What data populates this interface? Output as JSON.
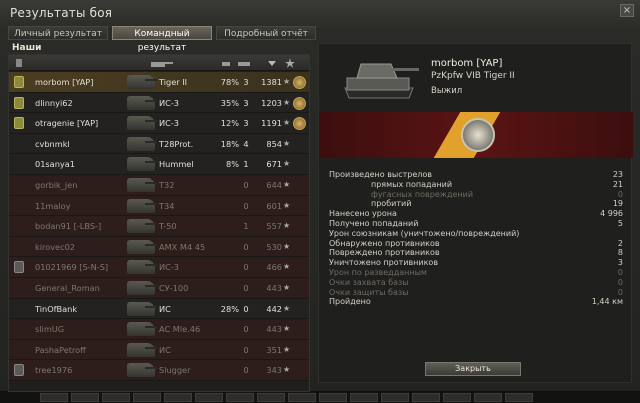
{
  "window": {
    "title": "Результаты боя",
    "close_label": "×"
  },
  "tabs": [
    {
      "label": "Личный результат",
      "active": false
    },
    {
      "label": "Командный результат",
      "active": true
    },
    {
      "label": "Подробный отчёт",
      "active": false
    }
  ],
  "team": {
    "header": "Наши"
  },
  "players": [
    {
      "name": "morbom [YAP]",
      "tank": "Tiger II",
      "pct": "78%",
      "kills": "3",
      "xp": "1381",
      "badge": "gold",
      "state": "self",
      "medal": true
    },
    {
      "name": "dlinnyi62",
      "tank": "ИС-3",
      "pct": "35%",
      "kills": "3",
      "xp": "1203",
      "badge": "gold",
      "state": "alive",
      "medal": true
    },
    {
      "name": "otragenie [YAP]",
      "tank": "ИС-3",
      "pct": "12%",
      "kills": "3",
      "xp": "1191",
      "badge": "gold",
      "state": "alive",
      "medal": true
    },
    {
      "name": "cvbnmkl",
      "tank": "T28Prot.",
      "pct": "18%",
      "kills": "4",
      "xp": "854",
      "badge": "",
      "state": "alive",
      "medal": false
    },
    {
      "name": "01sanya1",
      "tank": "Hummel",
      "pct": "8%",
      "kills": "1",
      "xp": "671",
      "badge": "",
      "state": "alive",
      "medal": false
    },
    {
      "name": "gorbik_jen",
      "tank": "T32",
      "pct": "",
      "kills": "0",
      "xp": "644",
      "badge": "",
      "state": "dead",
      "medal": false
    },
    {
      "name": "11maloy",
      "tank": "T34",
      "pct": "",
      "kills": "0",
      "xp": "601",
      "badge": "",
      "state": "dead",
      "medal": false
    },
    {
      "name": "bodan91 [-LBS-]",
      "tank": "T-50",
      "pct": "",
      "kills": "1",
      "xp": "557",
      "badge": "",
      "state": "dead",
      "medal": false
    },
    {
      "name": "kirovec02",
      "tank": "AMX M4 45",
      "pct": "",
      "kills": "0",
      "xp": "530",
      "badge": "",
      "state": "dead",
      "medal": false
    },
    {
      "name": "01021969 [S-N-S]",
      "tank": "ИС-3",
      "pct": "",
      "kills": "0",
      "xp": "466",
      "badge": "grey",
      "state": "dead",
      "medal": false
    },
    {
      "name": "General_Roman",
      "tank": "СУ-100",
      "pct": "",
      "kills": "0",
      "xp": "443",
      "badge": "",
      "state": "dead",
      "medal": false
    },
    {
      "name": "TinOfBank",
      "tank": "ИС",
      "pct": "28%",
      "kills": "0",
      "xp": "442",
      "badge": "",
      "state": "alive",
      "medal": false
    },
    {
      "name": "slimUG",
      "tank": "AC Mle.46",
      "pct": "",
      "kills": "0",
      "xp": "443",
      "badge": "",
      "state": "dead",
      "medal": false
    },
    {
      "name": "PashaPetroff",
      "tank": "ИС",
      "pct": "",
      "kills": "0",
      "xp": "351",
      "badge": "",
      "state": "dead",
      "medal": false
    },
    {
      "name": "tree1976",
      "tank": "Slugger",
      "pct": "",
      "kills": "0",
      "xp": "343",
      "badge": "grey",
      "state": "dead",
      "medal": false
    }
  ],
  "details": {
    "player": "morbom [YAP]",
    "tank": "PzKpfw VIB Tiger II",
    "status": "Выжил",
    "close_label": "Закрыть",
    "stats": [
      {
        "label": "Произведено выстрелов",
        "value": "23",
        "sub": false,
        "dim": false
      },
      {
        "label": "прямых попаданий",
        "value": "21",
        "sub": true,
        "dim": false
      },
      {
        "label": "фугасных повреждений",
        "value": "0",
        "sub": true,
        "dim": true
      },
      {
        "label": "пробитий",
        "value": "19",
        "sub": true,
        "dim": false
      },
      {
        "label": "Нанесено урона",
        "value": "4 996",
        "sub": false,
        "dim": false
      },
      {
        "label": "Получено попаданий",
        "value": "5",
        "sub": false,
        "dim": false
      },
      {
        "label": "Урон союзникам (уничтожено/повреждений)",
        "value": "",
        "sub": false,
        "dim": false
      },
      {
        "label": "Обнаружено противников",
        "value": "2",
        "sub": false,
        "dim": false
      },
      {
        "label": "Повреждено противников",
        "value": "8",
        "sub": false,
        "dim": false
      },
      {
        "label": "Уничтожено противников",
        "value": "3",
        "sub": false,
        "dim": false
      },
      {
        "label": "Урон по разведданным",
        "value": "0",
        "sub": false,
        "dim": true
      },
      {
        "label": "Очки захвата базы",
        "value": "0",
        "sub": false,
        "dim": true
      },
      {
        "label": "Очки защиты базы",
        "value": "0",
        "sub": false,
        "dim": true
      },
      {
        "label": "Пройдено",
        "value": "1,44 км",
        "sub": false,
        "dim": false
      }
    ]
  }
}
